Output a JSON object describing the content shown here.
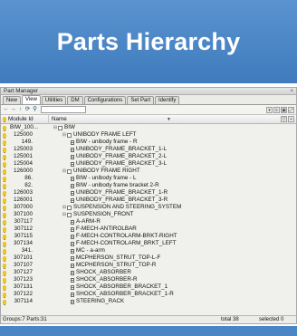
{
  "banner": {
    "title": "Parts Hierarchy"
  },
  "window": {
    "title": "Part Manager",
    "tabs": [
      "New",
      "View",
      "Utilities",
      "DM",
      "Configurations",
      "Set Part",
      "Identify"
    ],
    "search_value": "",
    "columns": {
      "module_id": "Module Id",
      "name": "Name"
    },
    "rows": [
      {
        "id": "BIW_100...",
        "name": "BIW",
        "kind": "assembly",
        "level": 0
      },
      {
        "id": "125000",
        "name": "UNIBODY FRAME LEFT",
        "kind": "assembly",
        "level": 1
      },
      {
        "id": "149.",
        "name": "BIW - unibody frame - R",
        "kind": "part",
        "level": 2
      },
      {
        "id": "125003",
        "name": "UNIBODY_FRAME_BRACKET_1-L",
        "kind": "part",
        "level": 2
      },
      {
        "id": "125001",
        "name": "UNIBODY_FRAME_BRACKET_2-L",
        "kind": "part",
        "level": 2
      },
      {
        "id": "125004",
        "name": "UNIBODY_FRAME_BRACKET_3-L",
        "kind": "part",
        "level": 2
      },
      {
        "id": "126000",
        "name": "UNIBODY FRAME RIGHT",
        "kind": "assembly",
        "level": 1
      },
      {
        "id": "86.",
        "name": "BIW - unibody frame - L",
        "kind": "part",
        "level": 2
      },
      {
        "id": "82.",
        "name": "BIW - unibody frame bracket 2-R",
        "kind": "part",
        "level": 2
      },
      {
        "id": "126003",
        "name": "UNIBODY_FRAME_BRACKET_1-R",
        "kind": "part",
        "level": 2
      },
      {
        "id": "126001",
        "name": "UNIBODY_FRAME_BRACKET_3-R",
        "kind": "part",
        "level": 2
      },
      {
        "id": "307000",
        "name": "SUSPENSION AND STEERING_SYSTEM",
        "kind": "assembly",
        "level": 1
      },
      {
        "id": "307100",
        "name": "SUSPENSION_FRONT",
        "kind": "assembly",
        "level": 1
      },
      {
        "id": "307117",
        "name": "A-ARM-R",
        "kind": "part",
        "level": 2
      },
      {
        "id": "307112",
        "name": "F-MECH-ANTIROLBAR",
        "kind": "part",
        "level": 2
      },
      {
        "id": "307115",
        "name": "F-MECH-CONTROLARM-BRKT-RIGHT",
        "kind": "part",
        "level": 2
      },
      {
        "id": "307134",
        "name": "F-MECH-CONTROLARM_BRKT_LEFT",
        "kind": "part",
        "level": 2
      },
      {
        "id": "341.",
        "name": "MC - a-arm",
        "kind": "part",
        "level": 2
      },
      {
        "id": "307101",
        "name": "MCPHERSON_STRUT_TOP-L-F",
        "kind": "part",
        "level": 2
      },
      {
        "id": "307107",
        "name": "MCPHERSON_STRUT_TOP-R",
        "kind": "part",
        "level": 2
      },
      {
        "id": "307127",
        "name": "SHOCK_ABSORBER",
        "kind": "part",
        "level": 2
      },
      {
        "id": "307123",
        "name": "SHOCK_ABSORBER-R",
        "kind": "part",
        "level": 2
      },
      {
        "id": "307131",
        "name": "SHOCK_ABSORBER_BRACKET_1",
        "kind": "part",
        "level": 2
      },
      {
        "id": "307122",
        "name": "SHOCK_ABSORBER_BRACKET_1-R",
        "kind": "part",
        "level": 2
      },
      {
        "id": "307114",
        "name": "STEERING_RACK",
        "kind": "part",
        "level": 2
      }
    ],
    "status": {
      "groups": "Groups:7 Parts:31",
      "total": "total   38",
      "selected": "selected 0"
    }
  },
  "colors": {
    "banner": "#4a86c5",
    "bulb": "#f0c419",
    "selection": "#c9d8ea"
  },
  "icons": [
    "back-icon",
    "forward-icon",
    "up-icon",
    "refresh-icon",
    "search-icon",
    "filter-icon",
    "lightbulb-icon",
    "folder-icon",
    "document-icon"
  ]
}
